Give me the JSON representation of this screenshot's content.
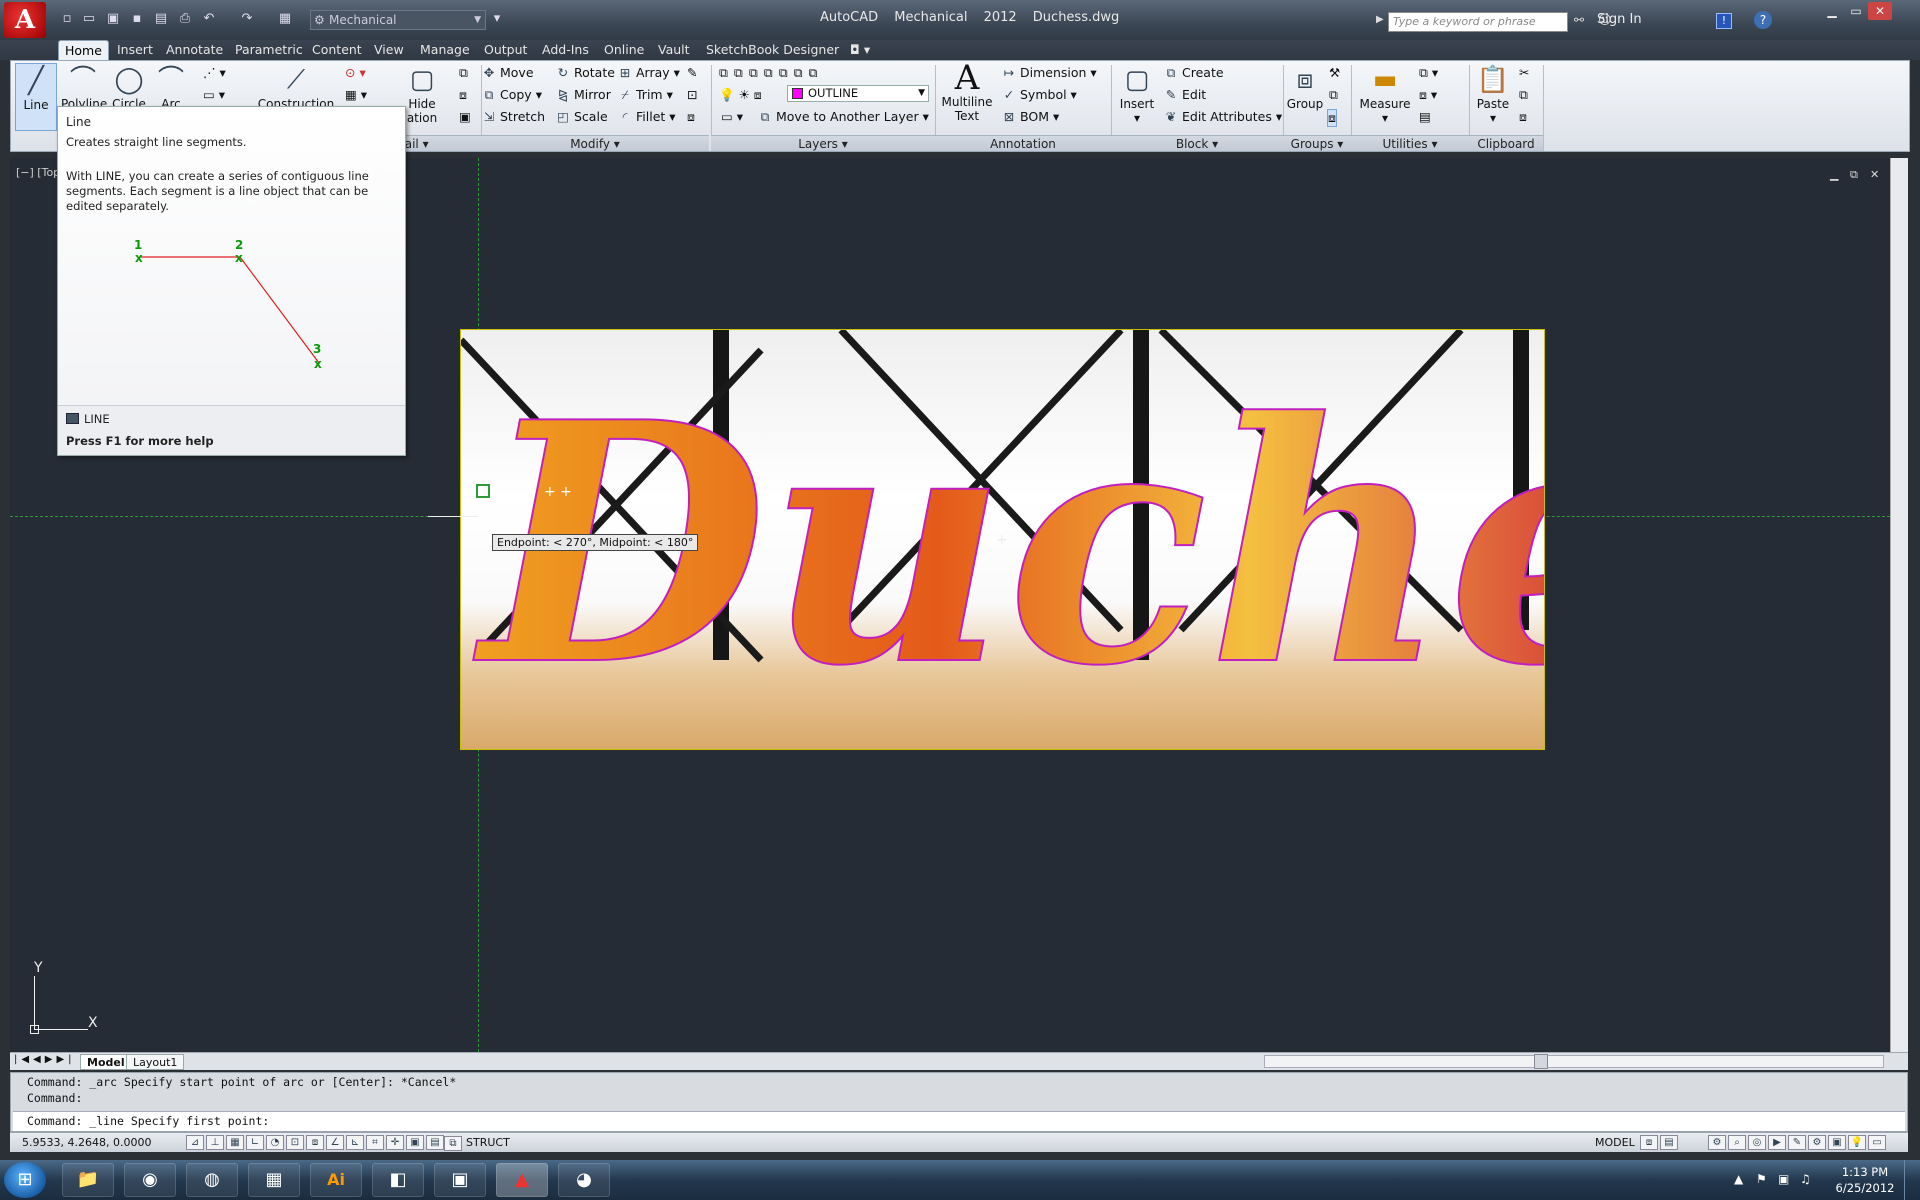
{
  "window": {
    "title_app": "AutoCAD Mechanical 2012",
    "title_file": "Duchess.dwg",
    "app_button": "A",
    "workspace": "Mechanical",
    "search_placeholder": "Type a keyword or phrase",
    "sign_in": "Sign In"
  },
  "tabs": [
    "Home",
    "Insert",
    "Annotate",
    "Parametric",
    "Content",
    "View",
    "Manage",
    "Output",
    "Add-Ins",
    "Online",
    "Vault",
    "SketchBook Designer"
  ],
  "ribbon": {
    "draw": {
      "line": "Line",
      "polyline": "Polyline",
      "circle": "Circle",
      "arc": "Arc",
      "construction": "Construction"
    },
    "detail": {
      "hide": "Hide",
      "ation": "ation",
      "title": "Detail"
    },
    "modify": {
      "move": "Move",
      "rotate": "Rotate",
      "array": "Array",
      "copy": "Copy",
      "mirror": "Mirror",
      "trim": "Trim",
      "stretch": "Stretch",
      "scale": "Scale",
      "fillet": "Fillet",
      "title": "Modify"
    },
    "layers": {
      "current": "OUTLINE",
      "move_layer": "Move to Another Layer",
      "title": "Layers",
      "color": "#ff00ff"
    },
    "annotation": {
      "mtext_1": "Multiline",
      "mtext_2": "Text",
      "dimension": "Dimension",
      "symbol": "Symbol",
      "bom": "BOM",
      "title": "Annotation"
    },
    "block": {
      "insert": "Insert",
      "create": "Create",
      "edit": "Edit",
      "edit_attr": "Edit Attributes",
      "title": "Block"
    },
    "groups": {
      "group": "Group",
      "title": "Groups"
    },
    "utilities": {
      "measure": "Measure",
      "title": "Utilities"
    },
    "clipboard": {
      "paste": "Paste",
      "title": "Clipboard"
    }
  },
  "tooltip": {
    "title": "Line",
    "desc": "Creates straight line segments.",
    "long": "With LINE, you can create a series of contiguous line segments. Each segment is a line object that can be edited separately.",
    "p1": "1",
    "p2": "2",
    "p3": "3",
    "command": "LINE",
    "help": "Press F1 for more help"
  },
  "viewport": {
    "label": "[−] [Top]",
    "snap_tip": "Endpoint: < 270°,  Midpoint: < 180°",
    "ucs_y": "Y",
    "ucs_x": "X",
    "image_text": "Duchess"
  },
  "layout_tabs": [
    "Model",
    "Layout1"
  ],
  "command": {
    "line1": "Command: _arc Specify start point of arc or [Center]: *Cancel*",
    "line2": "Command:",
    "input": "Command: _line Specify first point:"
  },
  "status": {
    "coords": "5.9533, 4.2648, 0.0000",
    "struct": "STRUCT",
    "model": "MODEL"
  },
  "taskbar": {
    "time": "1:13 PM",
    "date": "6/25/2012",
    "ai": "Ai"
  }
}
